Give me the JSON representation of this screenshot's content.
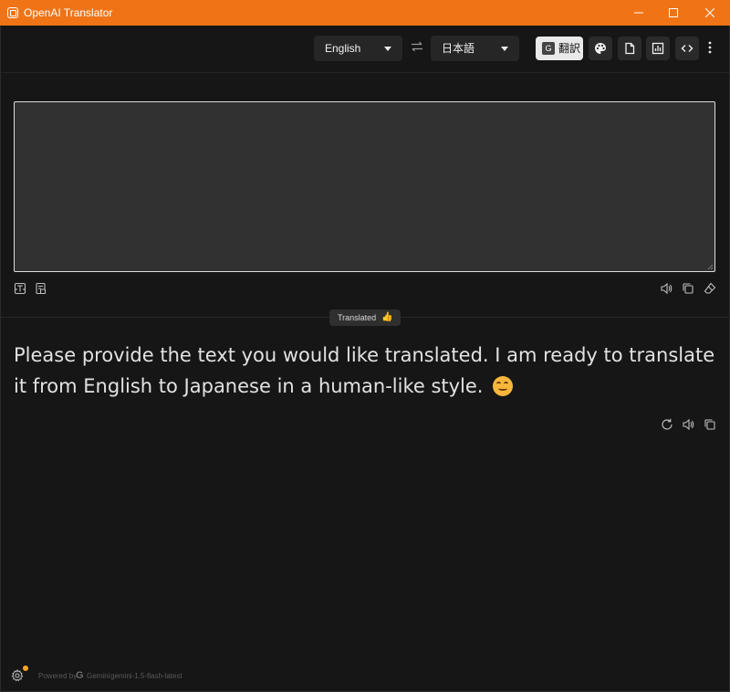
{
  "window": {
    "title": "OpenAI Translator"
  },
  "toolbar": {
    "source_language": "English",
    "target_language": "日本語",
    "translate_label": "翻訳",
    "translate_icon_glyph": "G"
  },
  "input": {
    "value": "",
    "placeholder": ""
  },
  "status": {
    "label": "Translated",
    "emoji": "👍"
  },
  "output": {
    "text": "Please provide the text you would like translated. I am ready to translate it from English to Japanese in a human-like style."
  },
  "footer": {
    "powered_by": "Powered by",
    "logo_glyph": "G",
    "provider": "Gemini",
    "model": "gemini-1.5-flash-latest"
  },
  "colors": {
    "titlebar": "#f07416",
    "background": "#161616",
    "input_bg": "#313131",
    "notification_dot": "#f5a623"
  },
  "icons": {
    "app": "app-icon",
    "swap": "swap-icon",
    "theme": "palette-icon",
    "file": "file-icon",
    "chart": "chart-icon",
    "code": "code-icon",
    "menu": "more-vertical-icon",
    "speak": "speaker-icon",
    "copy": "copy-icon",
    "clear": "eraser-icon",
    "retry": "refresh-icon",
    "settings": "gear-icon"
  }
}
